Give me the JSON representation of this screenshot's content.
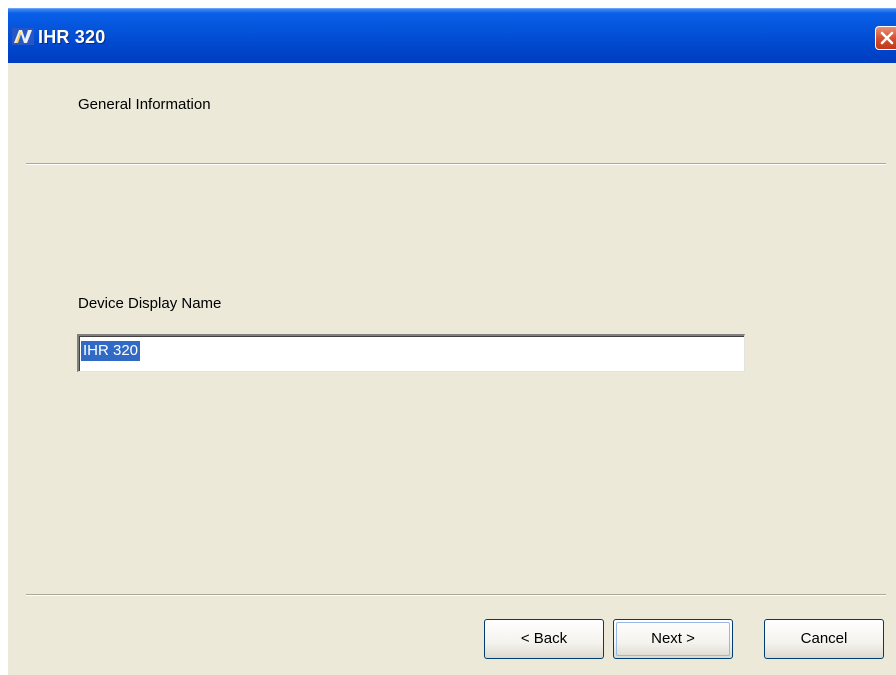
{
  "window": {
    "title": "IHR 320",
    "close_icon": "close-x-icon",
    "app_icon": "app-logo-icon"
  },
  "header": {
    "title": "General Information"
  },
  "form": {
    "device_display_name_label": "Device Display Name",
    "device_display_name_value": "IHR 320"
  },
  "buttons": {
    "back": "< Back",
    "next": "Next >",
    "cancel": "Cancel"
  },
  "colors": {
    "titlebar": "#0453d9",
    "dialog_bg": "#ece9d8",
    "selection": "#316ac5",
    "close_button": "#d4512f"
  }
}
